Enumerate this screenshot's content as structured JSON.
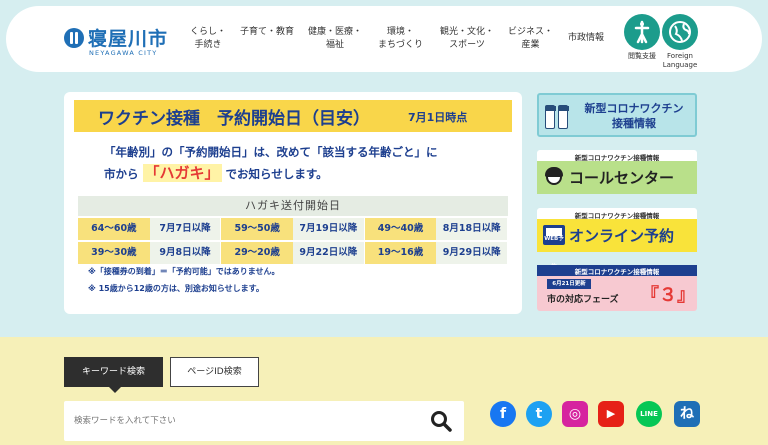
{
  "header": {
    "logo_text": "寝屋川市",
    "logo_sub": "NEYAGAWA CITY",
    "nav": [
      {
        "label": "くらし・\n手続き"
      },
      {
        "label": "子育て・教育"
      },
      {
        "label": "健康・医療・\n福祉"
      },
      {
        "label": "環境・\nまちづくり"
      },
      {
        "label": "観光・文化・\nスポーツ"
      },
      {
        "label": "ビジネス・\n産業"
      },
      {
        "label": "市政情報"
      }
    ],
    "accessibility_label": "閲覧支援",
    "language_label": "Foreign\nLanguage",
    "accent_color": "#1c9c8c",
    "brand_color": "#1f6fb6"
  },
  "notice": {
    "title": "ワクチン接種　予約開始日（目安）",
    "title_sub": "7月1日時点",
    "line1": "「年齢別」の「予約開始日」は、改めて「該当する年齢ごと」に",
    "line2_pre": "市から",
    "line2_hagaki": "「ハガキ」",
    "line2_post": "でお知らせします。",
    "table_header": "ハガキ送付開始日",
    "rows": [
      [
        {
          "age": "64～60歳",
          "date": "7月7日以降"
        },
        {
          "age": "59～50歳",
          "date": "7月19日以降"
        },
        {
          "age": "49～40歳",
          "date": "8月18日以降"
        }
      ],
      [
        {
          "age": "39～30歳",
          "date": "9月8日以降"
        },
        {
          "age": "29～20歳",
          "date": "9月22日以降"
        },
        {
          "age": "19～16歳",
          "date": "9月29日以降"
        }
      ]
    ],
    "note1": "※「接種券の到着」＝「予約可能」ではありません。",
    "note2": "※ 15歳から12歳の方は、別途お知らせします。"
  },
  "banners": {
    "vaccine_info": "新型コロナワクチン\n接種情報",
    "small_label": "新型コロナワクチン接種情報",
    "call_center": "コールセンター",
    "online": "オンライン予約",
    "web_icon": "WEB予約",
    "phase_badge": "6月21日更新",
    "phase_text": "市の対応フェーズ",
    "phase_num": "『３』"
  },
  "search": {
    "tab_keyword": "キーワード検索",
    "tab_pageid": "ページID検索",
    "placeholder": "検索ワードを入れて下さい"
  },
  "social": [
    {
      "icon": "facebook-icon",
      "glyph": "f",
      "color": "#1877f2"
    },
    {
      "icon": "twitter-icon",
      "glyph": "t",
      "color": "#1da1f2"
    },
    {
      "icon": "instagram-icon",
      "glyph": "◎",
      "color": "#d6249f"
    },
    {
      "icon": "youtube-icon",
      "glyph": "▶",
      "color": "#e62117"
    },
    {
      "icon": "line-icon",
      "glyph": "LINE",
      "color": "#06c755"
    },
    {
      "icon": "neyagawa-app-icon",
      "glyph": "ね",
      "color": "#1f6fb6"
    }
  ]
}
